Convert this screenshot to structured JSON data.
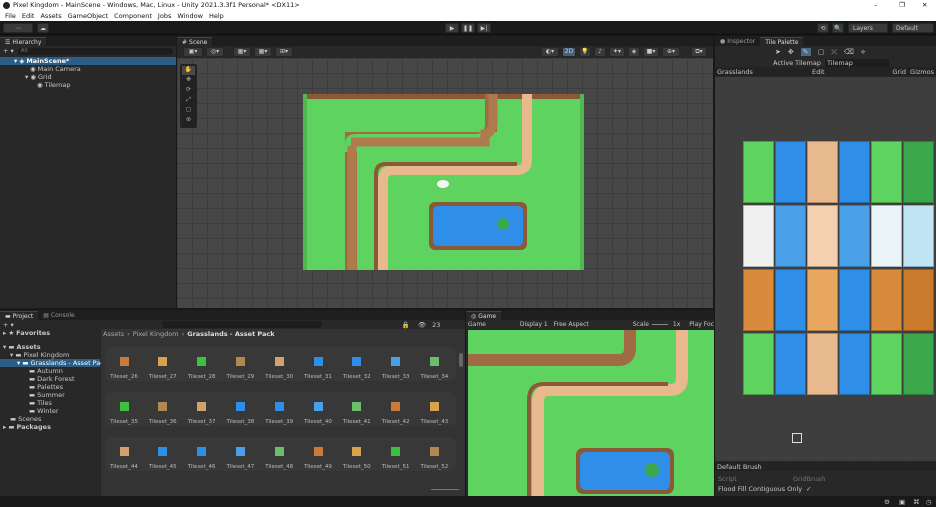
{
  "window": {
    "title": "Pixel Kingdom - MainScene - Windows, Mac, Linux - Unity 2021.3.3f1 Personal* <DX11>",
    "min": "–",
    "max": "❐",
    "close": "✕"
  },
  "menu": [
    "File",
    "Edit",
    "Assets",
    "GameObject",
    "Component",
    "Jobs",
    "Window",
    "Help"
  ],
  "toolbar": {
    "account": "⋯",
    "cloud": "☁",
    "play": "▶",
    "pause": "❚❚",
    "step": "▶|",
    "history": "⟲",
    "search": "🔍",
    "layers": "Layers",
    "layout": "Default"
  },
  "hierarchy": {
    "tab": "Hierarchy",
    "search_placeholder": "All",
    "add": "+ ▾",
    "items": [
      {
        "label": "MainScene*"
      },
      {
        "label": "Main Camera"
      },
      {
        "label": "Grid"
      },
      {
        "label": "Tilemap"
      }
    ]
  },
  "scene": {
    "tab": "Scene",
    "mode_2d": "2D"
  },
  "project": {
    "tab": "Project",
    "console_tab": "Console",
    "add": "+ ▾",
    "favorites": "Favorites",
    "assets": "Assets",
    "badge": "23",
    "breadcrumb": [
      "Assets",
      "Pixel Kingdom",
      "Grasslands - Asset Pack"
    ],
    "folders": [
      "Pixel Kingdom",
      "Grasslands - Asset Pack",
      "Autumn",
      "Dark Forest",
      "Palettes",
      "Summer",
      "Tiles",
      "Winter",
      "Scenes"
    ],
    "packages": "Packages",
    "rows": [
      [
        "Tileset_26",
        "Tileset_27",
        "Tileset_28",
        "Tileset_29",
        "Tileset_30",
        "Tileset_31",
        "Tileset_32",
        "Tileset_33",
        "Tileset_34"
      ],
      [
        "Tileset_35",
        "Tileset_36",
        "Tileset_37",
        "Tileset_38",
        "Tileset_39",
        "Tileset_40",
        "Tileset_41",
        "Tileset_42",
        "Tileset_43"
      ],
      [
        "Tileset_44",
        "Tileset_45",
        "Tileset_46",
        "Tileset_47",
        "Tileset_48",
        "Tileset_49",
        "Tileset_50",
        "Tileset_51",
        "Tileset_52"
      ]
    ]
  },
  "game": {
    "tab": "Game",
    "mode": "Game",
    "display": "Display 1",
    "aspect": "Free Aspect",
    "scale_label": "Scale",
    "scale_value": "1x",
    "play_focused": "Play Foc"
  },
  "inspector": {
    "tab": "Inspector",
    "palette_tab": "Tile Palette",
    "active_tilemap_label": "Active Tilemap",
    "active_tilemap": "Tilemap",
    "palette": "Grasslands",
    "edit": "Edit",
    "grid": "Grid",
    "gizmos": "Gizmos",
    "brush": "Default Brush",
    "script_label": "Script",
    "script_value": "GridBrush",
    "flood_label": "Flood Fill Contiguous Only",
    "flood_check": "✓"
  },
  "colors": {
    "grass": "#5fd35f",
    "dirt": "#b07a4f",
    "path": "#e8b98c",
    "water": "#2f8fe8",
    "editor_bg": "#191919",
    "panel": "#282828"
  }
}
